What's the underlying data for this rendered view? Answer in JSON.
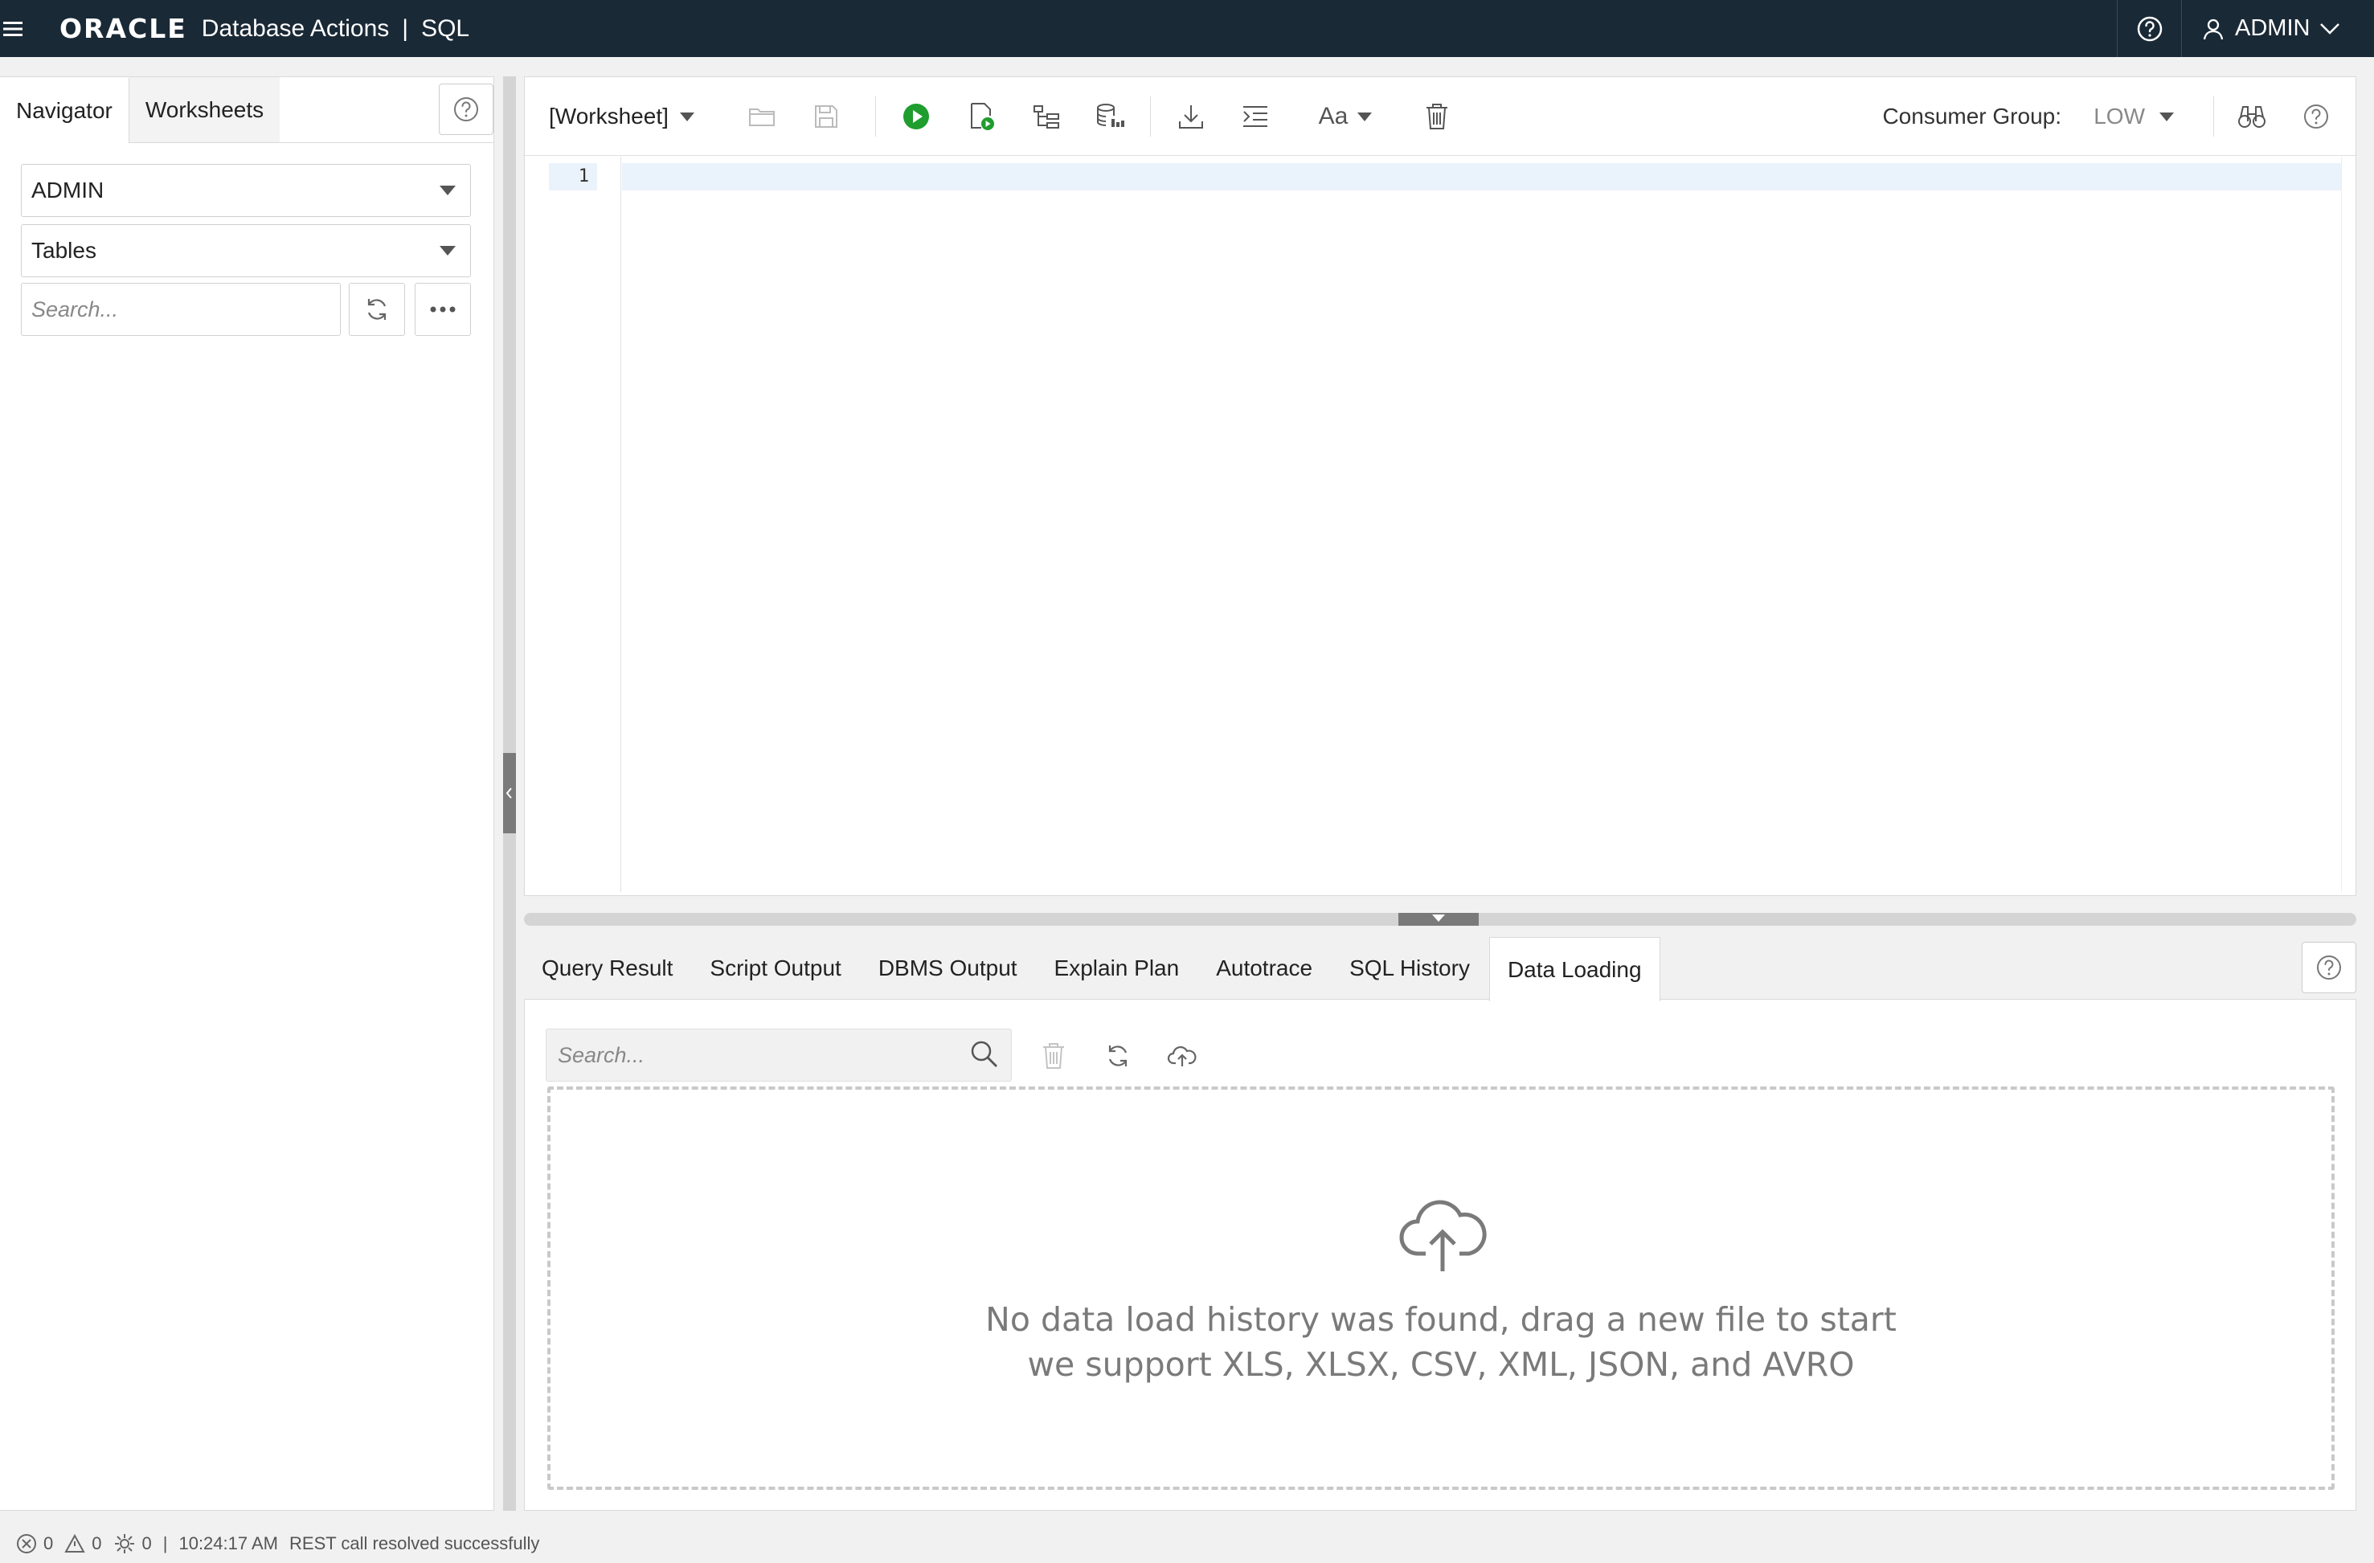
{
  "header": {
    "logo": "ORACLE",
    "product": "Database Actions",
    "separator": "|",
    "page": "SQL",
    "user": "ADMIN"
  },
  "navigator": {
    "tabs": [
      {
        "label": "Navigator",
        "active": true
      },
      {
        "label": "Worksheets",
        "active": false
      }
    ],
    "schema": "ADMIN",
    "object_type": "Tables",
    "search_placeholder": "Search..."
  },
  "worksheet": {
    "name": "[Worksheet]",
    "consumer_group_label": "Consumer Group:",
    "consumer_group_value": "LOW",
    "line_numbers": [
      "1"
    ],
    "font_button": "Aa"
  },
  "output": {
    "tabs": [
      {
        "label": "Query Result"
      },
      {
        "label": "Script Output"
      },
      {
        "label": "DBMS Output"
      },
      {
        "label": "Explain Plan"
      },
      {
        "label": "Autotrace"
      },
      {
        "label": "SQL History"
      },
      {
        "label": "Data Loading",
        "active": true
      }
    ],
    "search_placeholder": "Search...",
    "empty_message_line1": "No data load history was found, drag a new file to start",
    "empty_message_line2": "we support XLS, XLSX, CSV, XML, JSON, and AVRO"
  },
  "status": {
    "errors": "0",
    "warnings": "0",
    "tasks": "0",
    "separator": "|",
    "time": "10:24:17 AM",
    "message": "REST call resolved successfully"
  },
  "colors": {
    "header_bg": "#1a2936",
    "run_green": "#1f9d2e"
  }
}
